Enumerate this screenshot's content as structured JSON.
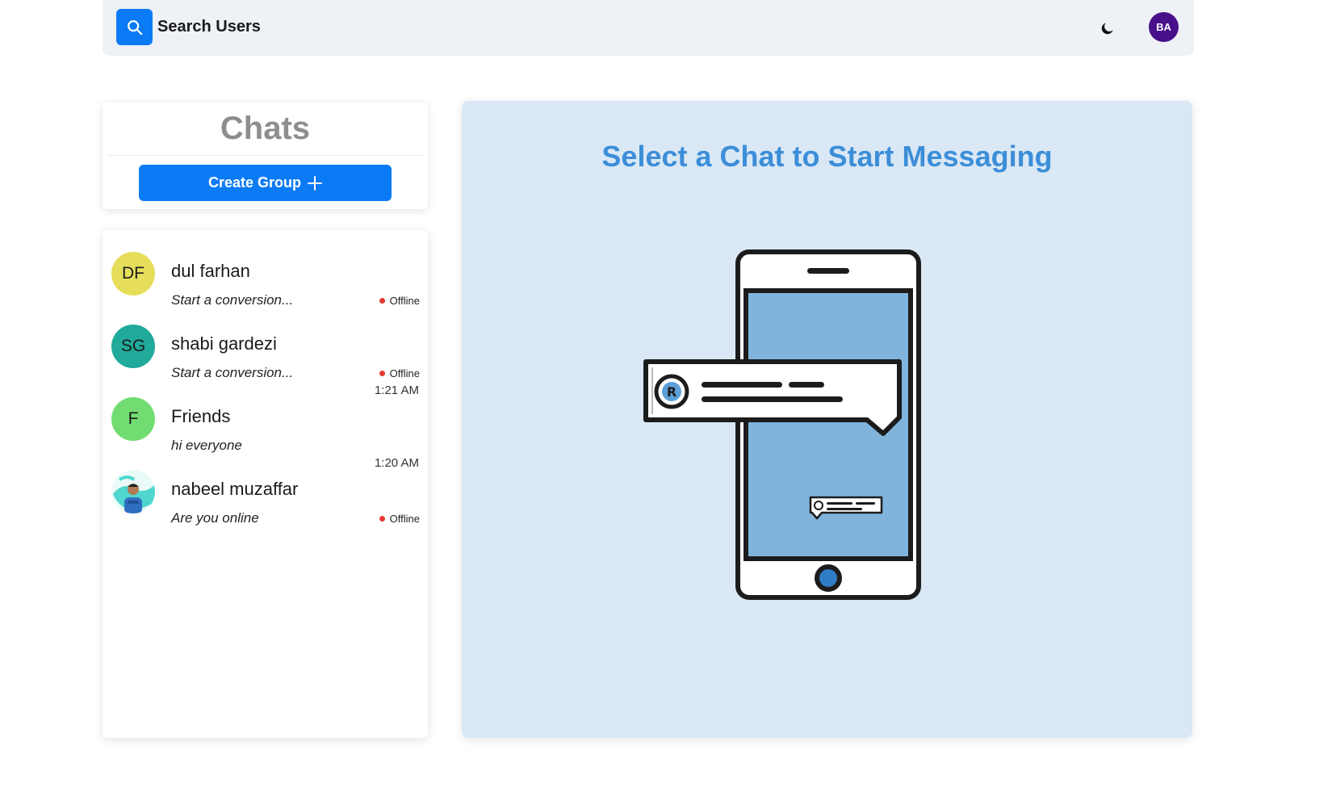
{
  "header": {
    "search_label": "Search Users",
    "user_initials": "BA"
  },
  "sidebar": {
    "title": "Chats",
    "create_group_label": "Create Group"
  },
  "chats": [
    {
      "initials": "DF",
      "name": "dul farhan",
      "preview": "Start a conversion...",
      "status": "Offline",
      "time": "",
      "avatar_color": "#e6dd5b"
    },
    {
      "initials": "SG",
      "name": "shabi gardezi",
      "preview": "Start a conversion...",
      "status": "Offline",
      "time": "",
      "avatar_color": "#20aa9a"
    },
    {
      "initials": "F",
      "name": "Friends",
      "preview": "hi everyone",
      "status": "",
      "time": "1:21 AM",
      "avatar_color": "#71dc72"
    },
    {
      "initials": "",
      "name": "nabeel muzaffar",
      "preview": "Are you online",
      "status": "Offline",
      "time": "1:20 AM",
      "avatar_color": "#4ed6cf"
    }
  ],
  "main": {
    "title": "Select a Chat to Start Messaging"
  },
  "colors": {
    "accent": "#0b7bf5",
    "offline": "#e53935",
    "panel_bg": "#dae8f5",
    "title_blue": "#3c8ed8"
  }
}
